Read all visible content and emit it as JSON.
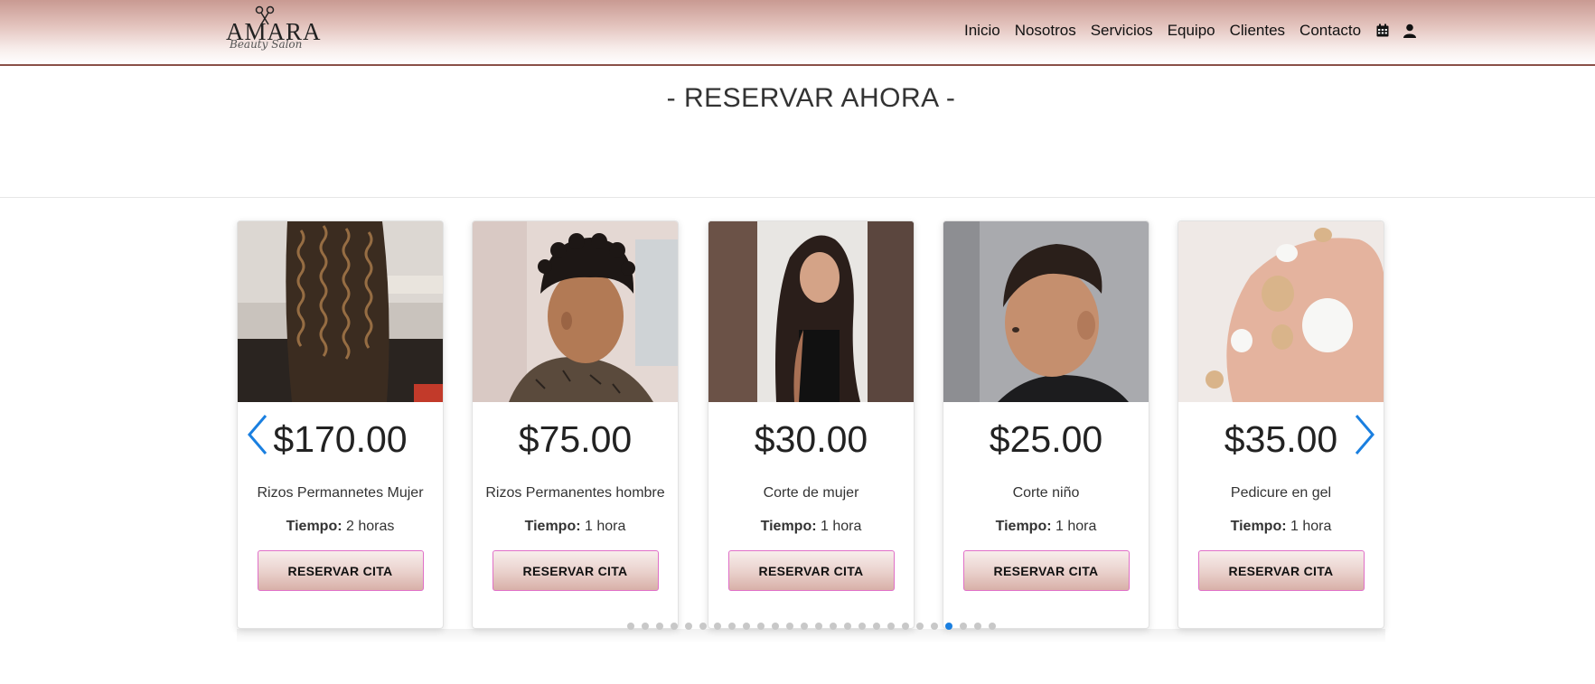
{
  "brand": {
    "logo_text": "AMARA",
    "logo_script": "Beauty Salon"
  },
  "nav": {
    "items": [
      "Inicio",
      "Nosotros",
      "Servicios",
      "Equipo",
      "Clientes",
      "Contacto"
    ],
    "icons": [
      "calendar-icon",
      "user-icon"
    ]
  },
  "section": {
    "title": "- RESERVAR AHORA -"
  },
  "services": [
    {
      "price": "$170.00",
      "name": "Rizos Permannetes Mujer",
      "time_label": "Tiempo:",
      "time_value": "2 horas",
      "button": "RESERVAR CITA"
    },
    {
      "price": "$75.00",
      "name": "Rizos Permanentes hombre",
      "time_label": "Tiempo:",
      "time_value": "1 hora",
      "button": "RESERVAR CITA"
    },
    {
      "price": "$30.00",
      "name": "Corte de mujer",
      "time_label": "Tiempo:",
      "time_value": "1 hora",
      "button": "RESERVAR CITA"
    },
    {
      "price": "$25.00",
      "name": "Corte niño",
      "time_label": "Tiempo:",
      "time_value": "1 hora",
      "button": "RESERVAR CITA"
    },
    {
      "price": "$35.00",
      "name": "Pedicure en gel",
      "time_label": "Tiempo:",
      "time_value": "1 hora",
      "button": "RESERVAR CITA"
    }
  ],
  "carousel": {
    "dot_count": 26,
    "active_dot": 22,
    "prev_icon": "chevron-left-icon",
    "next_icon": "chevron-right-icon"
  },
  "colors": {
    "header_top": "#c99a92",
    "accent_blue": "#1a7fe0",
    "button_border": "#e070c8"
  }
}
